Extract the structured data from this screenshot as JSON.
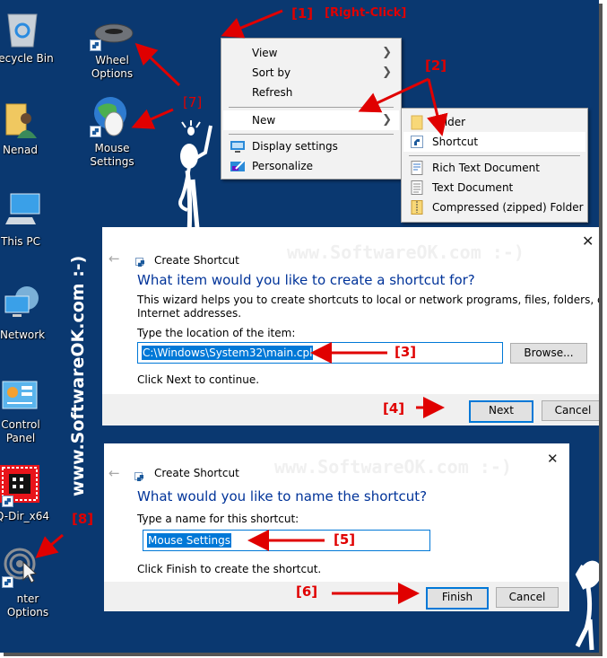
{
  "desktop": {
    "background": "#0a3870",
    "icons": [
      {
        "name": "recycle-bin",
        "label": "ecycle Bin"
      },
      {
        "name": "wheel-options",
        "label": "Wheel Options"
      },
      {
        "name": "nenad",
        "label": "Nenad"
      },
      {
        "name": "mouse-settings",
        "label": "Mouse Settings"
      },
      {
        "name": "this-pc",
        "label": "This PC"
      },
      {
        "name": "network",
        "label": "Network"
      },
      {
        "name": "control-panel",
        "label": "Control Panel"
      },
      {
        "name": "q-dir",
        "label": "Q-Dir_x64"
      },
      {
        "name": "pointer-options",
        "label": "nter Options"
      }
    ],
    "vertical_watermark": "www.SoftwareOK.com :-)"
  },
  "annotations": {
    "step1": "[1]",
    "step1_note": "[Right-Click]",
    "step2": "[2]",
    "step3": "[3]",
    "step4": "[4]",
    "step5": "[5]",
    "step6": "[6]",
    "step7": "[7]",
    "step8": "[8]",
    "accent": "#e00000"
  },
  "context_menu": {
    "items": [
      {
        "label": "View",
        "submenu": true
      },
      {
        "label": "Sort by",
        "submenu": true
      },
      {
        "label": "Refresh",
        "submenu": false
      },
      {
        "label": "New",
        "submenu": true,
        "highlighted": true
      },
      {
        "label": "Display settings",
        "icon": "display-icon"
      },
      {
        "label": "Personalize",
        "icon": "personalize-icon"
      }
    ]
  },
  "new_submenu": {
    "items": [
      {
        "label": "Folder",
        "icon": "folder-icon"
      },
      {
        "label": "Shortcut",
        "icon": "shortcut-icon",
        "highlighted": true
      },
      {
        "label": "Rich Text Document",
        "icon": "rtf-document-icon"
      },
      {
        "label": "Text Document",
        "icon": "text-document-icon"
      },
      {
        "label": "Compressed (zipped) Folder",
        "icon": "zip-folder-icon"
      }
    ]
  },
  "dialog1": {
    "title": "Create Shortcut",
    "watermark": "www.SoftwareOK.com :-)",
    "heading": "What item would you like to create a shortcut for?",
    "description_line1": "This wizard helps you to create shortcuts to local or network programs, files, folders, computers, or",
    "description_line2": "Internet addresses.",
    "field_label": "Type the location of the item:",
    "field_value": "C:\\Windows\\System32\\main.cpl",
    "browse_label": "Browse...",
    "hint": "Click Next to continue.",
    "next_label": "Next",
    "cancel_label": "Cancel"
  },
  "dialog2": {
    "title": "Create Shortcut",
    "watermark": "www.SoftwareOK.com :-)",
    "heading": "What would you like to name the shortcut?",
    "field_label": "Type a name for this shortcut:",
    "field_value": "Mouse Settings",
    "hint": "Click Finish to create the shortcut.",
    "finish_label": "Finish",
    "cancel_label": "Cancel"
  }
}
